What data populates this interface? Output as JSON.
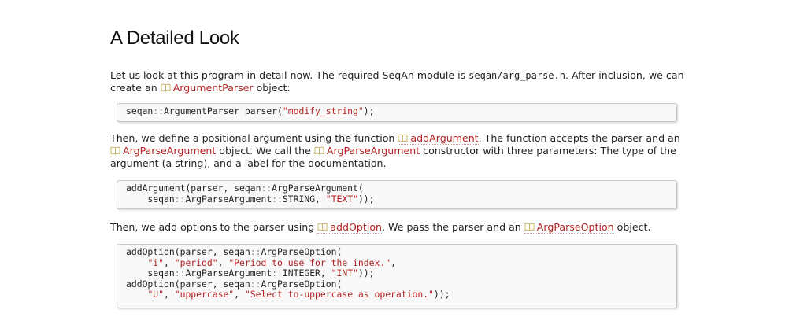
{
  "heading": "A Detailed Look",
  "para1": {
    "t1": "Let us look at this program in detail now. The required SeqAn module is ",
    "code": "seqan/arg_parse.h",
    "t2": ". After inclusion, we can create an ",
    "link": "ArgumentParser",
    "t3": " object:"
  },
  "code1": {
    "lines": [
      [
        {
          "t": "seqan",
          "c": "plain"
        },
        {
          "t": "::",
          "c": "op"
        },
        {
          "t": "ArgumentParser parser(",
          "c": "plain"
        },
        {
          "t": "\"modify_string\"",
          "c": "str"
        },
        {
          "t": ");",
          "c": "plain"
        }
      ]
    ]
  },
  "para2": {
    "t1": "Then, we define a positional argument using the function ",
    "link1": "addArgument",
    "t2": ". The function accepts the parser and an ",
    "link2": "ArgParseArgument",
    "t3": " object. We call the ",
    "link3": "ArgParseArgument",
    "t4": " constructor with three parameters: The type of the argument (a string), and a label for the documentation."
  },
  "code2": {
    "lines": [
      [
        {
          "t": "addArgument(parser, seqan",
          "c": "plain"
        },
        {
          "t": "::",
          "c": "op"
        },
        {
          "t": "ArgParseArgument(",
          "c": "plain"
        }
      ],
      [
        {
          "t": "    seqan",
          "c": "plain"
        },
        {
          "t": "::",
          "c": "op"
        },
        {
          "t": "ArgParseArgument",
          "c": "plain"
        },
        {
          "t": "::",
          "c": "op"
        },
        {
          "t": "STRING, ",
          "c": "plain"
        },
        {
          "t": "\"TEXT\"",
          "c": "str"
        },
        {
          "t": "));",
          "c": "plain"
        }
      ]
    ]
  },
  "para3": {
    "t1": "Then, we add options to the parser using ",
    "link1": "addOption",
    "t2": ". We pass the parser and an ",
    "link2": "ArgParseOption",
    "t3": " object."
  },
  "code3": {
    "lines": [
      [
        {
          "t": "addOption(parser, seqan",
          "c": "plain"
        },
        {
          "t": "::",
          "c": "op"
        },
        {
          "t": "ArgParseOption(",
          "c": "plain"
        }
      ],
      [
        {
          "t": "    ",
          "c": "plain"
        },
        {
          "t": "\"i\"",
          "c": "str"
        },
        {
          "t": ", ",
          "c": "plain"
        },
        {
          "t": "\"period\"",
          "c": "str"
        },
        {
          "t": ", ",
          "c": "plain"
        },
        {
          "t": "\"Period to use for the index.\"",
          "c": "str"
        },
        {
          "t": ",",
          "c": "plain"
        }
      ],
      [
        {
          "t": "    seqan",
          "c": "plain"
        },
        {
          "t": "::",
          "c": "op"
        },
        {
          "t": "ArgParseArgument",
          "c": "plain"
        },
        {
          "t": "::",
          "c": "op"
        },
        {
          "t": "INTEGER, ",
          "c": "plain"
        },
        {
          "t": "\"INT\"",
          "c": "str"
        },
        {
          "t": "));",
          "c": "plain"
        }
      ],
      [
        {
          "t": "addOption(parser, seqan",
          "c": "plain"
        },
        {
          "t": "::",
          "c": "op"
        },
        {
          "t": "ArgParseOption(",
          "c": "plain"
        }
      ],
      [
        {
          "t": "    ",
          "c": "plain"
        },
        {
          "t": "\"U\"",
          "c": "str"
        },
        {
          "t": ", ",
          "c": "plain"
        },
        {
          "t": "\"uppercase\"",
          "c": "str"
        },
        {
          "t": ", ",
          "c": "plain"
        },
        {
          "t": "\"Select to-uppercase as operation.\"",
          "c": "str"
        },
        {
          "t": "));",
          "c": "plain"
        }
      ]
    ]
  },
  "icon": "book-icon",
  "colors": {
    "link": "#b22222",
    "string": "#b22222",
    "code_bg": "#f8f8f8"
  }
}
